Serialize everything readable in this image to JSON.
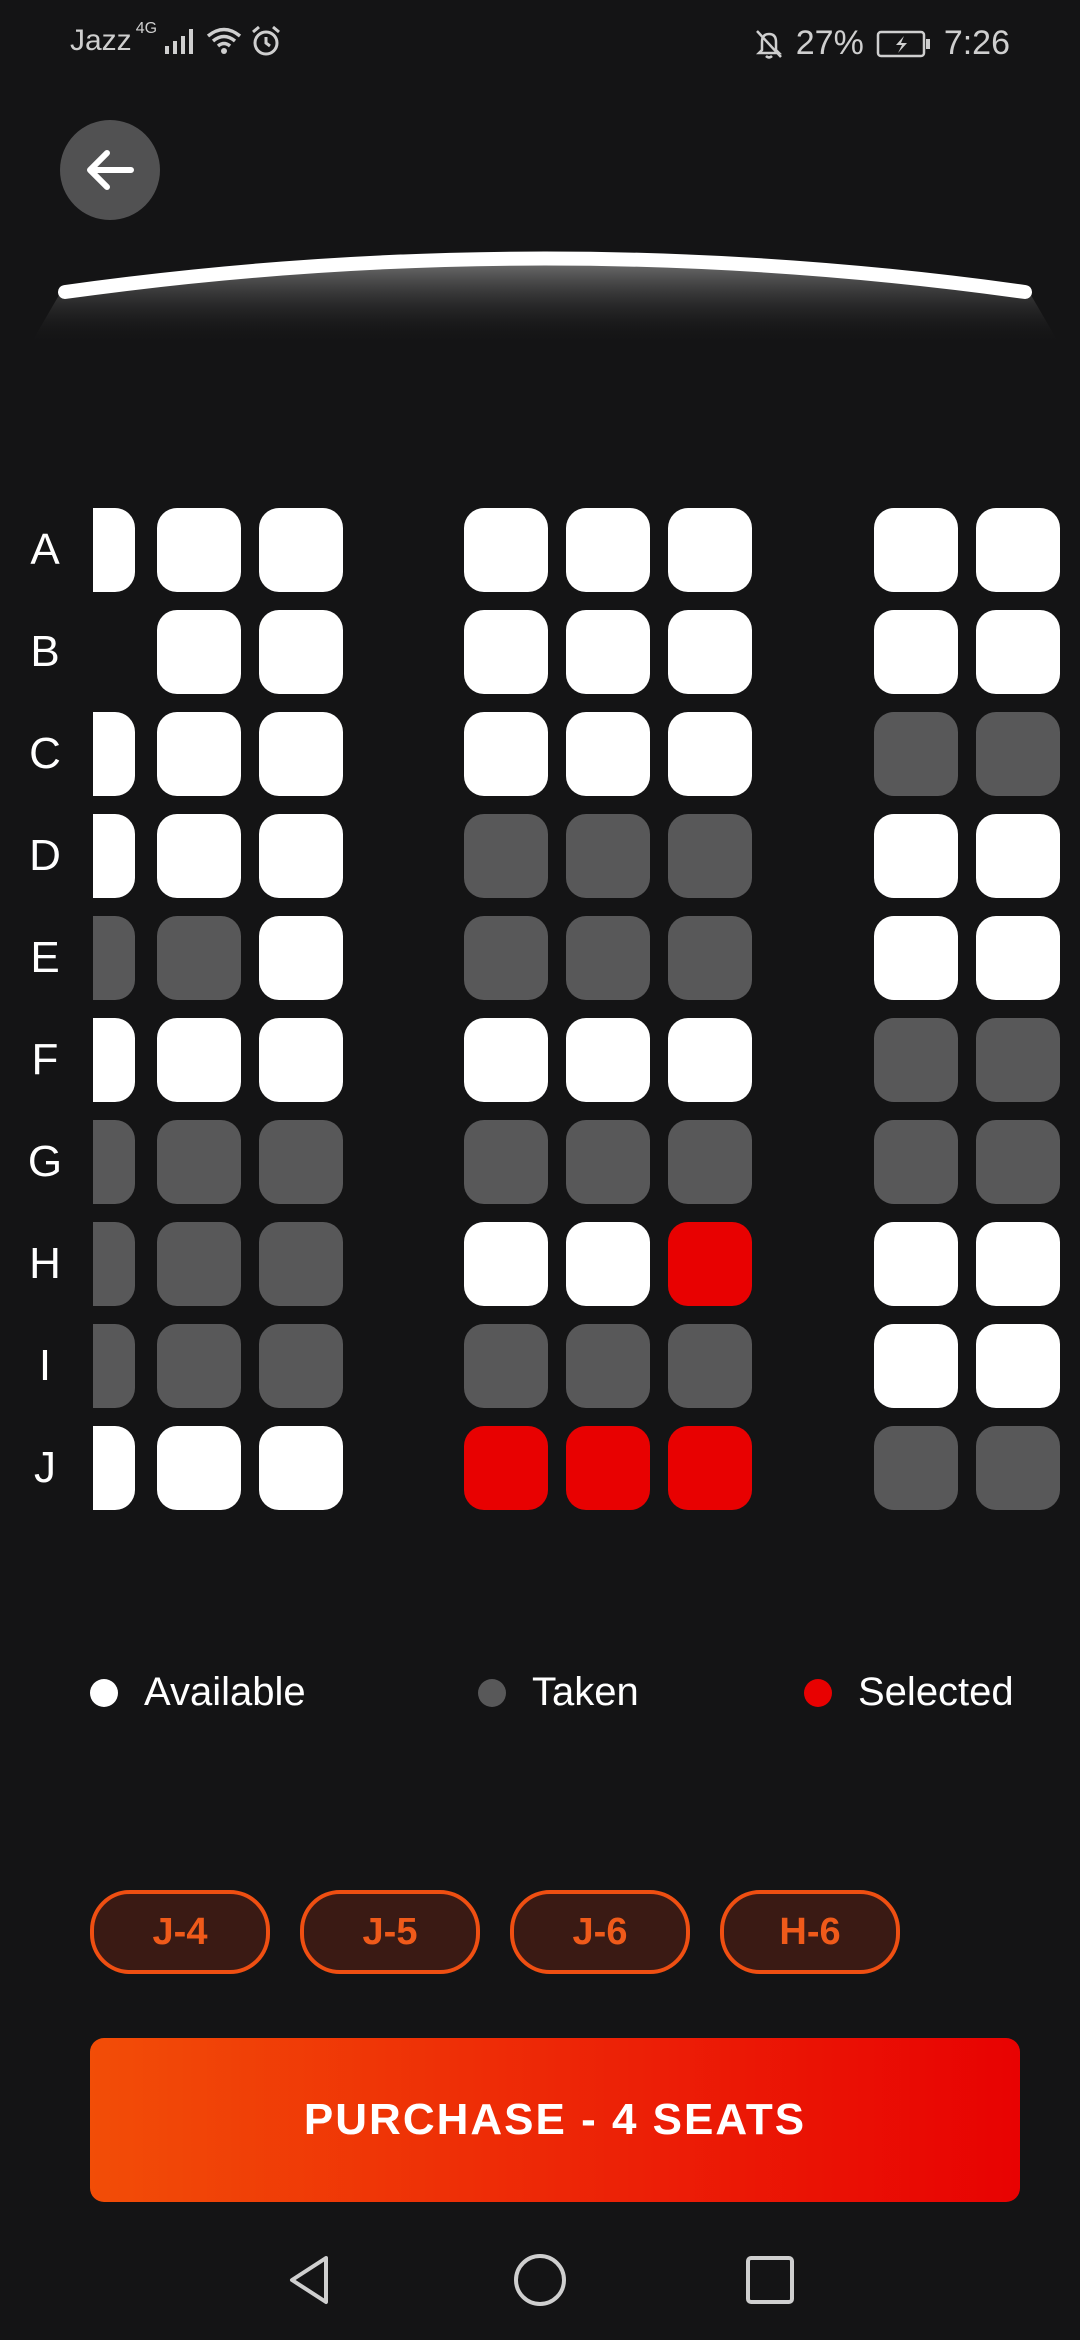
{
  "status_bar": {
    "carrier": "Jazz",
    "network": "4G",
    "battery": "27%",
    "time": "7:26",
    "icons": [
      "signal-icon",
      "wifi-icon",
      "alarm-icon",
      "bell-off-icon",
      "battery-charging-icon"
    ]
  },
  "header": {
    "back_icon": "arrow-left-icon"
  },
  "rows": [
    {
      "label": "A",
      "seats": [
        "available",
        "available",
        "available",
        "available",
        "available",
        "available",
        "available",
        "available"
      ]
    },
    {
      "label": "B",
      "seats": [
        "none",
        "available",
        "available",
        "available",
        "available",
        "available",
        "available",
        "available"
      ]
    },
    {
      "label": "C",
      "seats": [
        "available",
        "available",
        "available",
        "available",
        "available",
        "available",
        "taken",
        "taken"
      ]
    },
    {
      "label": "D",
      "seats": [
        "available",
        "available",
        "available",
        "taken",
        "taken",
        "taken",
        "available",
        "available"
      ]
    },
    {
      "label": "E",
      "seats": [
        "taken",
        "taken",
        "available",
        "taken",
        "taken",
        "taken",
        "available",
        "available"
      ]
    },
    {
      "label": "F",
      "seats": [
        "available",
        "available",
        "available",
        "available",
        "available",
        "available",
        "taken",
        "taken"
      ]
    },
    {
      "label": "G",
      "seats": [
        "taken",
        "taken",
        "taken",
        "taken",
        "taken",
        "taken",
        "taken",
        "taken"
      ]
    },
    {
      "label": "H",
      "seats": [
        "taken",
        "taken",
        "taken",
        "available",
        "available",
        "selected",
        "available",
        "available"
      ]
    },
    {
      "label": "I",
      "seats": [
        "taken",
        "taken",
        "taken",
        "taken",
        "taken",
        "taken",
        "available",
        "available"
      ]
    },
    {
      "label": "J",
      "seats": [
        "available",
        "available",
        "available",
        "selected",
        "selected",
        "selected",
        "taken",
        "taken"
      ]
    }
  ],
  "legend": {
    "available": "Available",
    "taken": "Taken",
    "selected": "Selected"
  },
  "colors": {
    "available": "#ffffff",
    "taken": "#585859",
    "selected": "#e80101",
    "accent": "#ef4f12"
  },
  "selected_seats": [
    "J-4",
    "J-5",
    "J-6",
    "H-6"
  ],
  "purchase_label": "PURCHASE - 4 SEATS",
  "nav": {
    "back": "nav-back-icon",
    "home": "nav-home-icon",
    "recents": "nav-recents-icon"
  }
}
